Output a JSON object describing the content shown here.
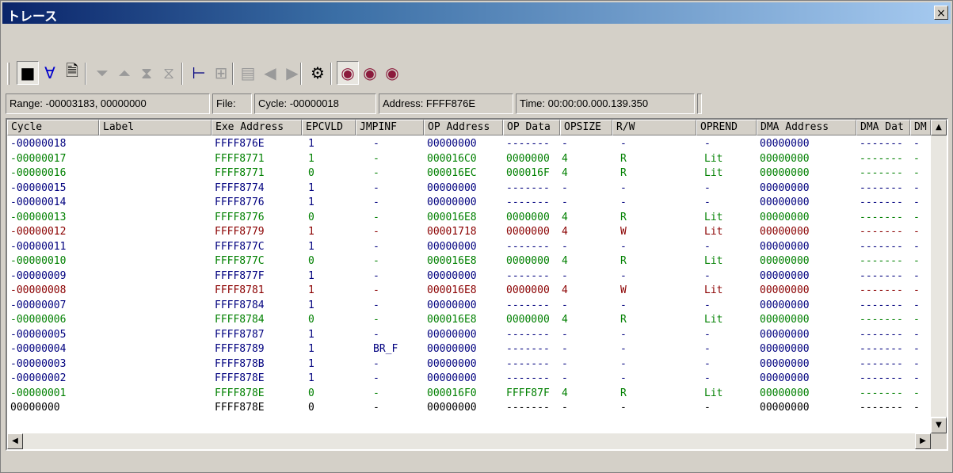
{
  "window": {
    "title": "トレース",
    "close_glyph": "×"
  },
  "toolbar": {
    "buttons": [
      {
        "name": "trace-display-icon",
        "glyph": "■",
        "color": "#000000",
        "pressed": true
      },
      {
        "name": "filter-icon",
        "glyph": "∀",
        "color": "#0000cc"
      },
      {
        "name": "document-icon",
        "glyph": "🗎",
        "color": "#000000"
      },
      {
        "name": "filter-down-icon",
        "glyph": "⏷",
        "color": "#9a9a9a",
        "disabled": true
      },
      {
        "name": "eject-up-icon",
        "glyph": "⏶",
        "color": "#9a9a9a",
        "disabled": true
      },
      {
        "name": "collapse-icon",
        "glyph": "⧗",
        "color": "#9a9a9a",
        "disabled": true
      },
      {
        "name": "expand-icon",
        "glyph": "⧖",
        "color": "#9a9a9a",
        "disabled": true
      },
      {
        "name": "tree-icon",
        "glyph": "⊢",
        "color": "#000080"
      },
      {
        "name": "tree-alt-icon",
        "glyph": "⊞",
        "color": "#9a9a9a",
        "disabled": true
      },
      {
        "name": "list-icon",
        "glyph": "▤",
        "color": "#9a9a9a",
        "disabled": true
      },
      {
        "name": "step-back-icon",
        "glyph": "◀",
        "color": "#9a9a9a",
        "disabled": true
      },
      {
        "name": "step-forward-icon",
        "glyph": "▶",
        "color": "#9a9a9a",
        "disabled": true
      },
      {
        "name": "properties-icon",
        "glyph": "⚙",
        "color": "#000000"
      },
      {
        "name": "record-zoom-icon",
        "glyph": "◉",
        "color": "#8b1a3c",
        "pressed": true
      },
      {
        "name": "record-stop-icon",
        "glyph": "◉",
        "color": "#8b1a3c"
      },
      {
        "name": "record-reset-icon",
        "glyph": "◉",
        "color": "#8b1a3c"
      }
    ]
  },
  "status_bar": {
    "range": "Range: -00003183, 00000000",
    "file": "File:",
    "cycle": "Cycle: -00000018",
    "address": "Address: FFFF876E",
    "time": "Time: 00:00:00.000.139.350"
  },
  "columns": [
    "Cycle",
    "Label",
    "Exe Address",
    "EPCVLD",
    "JMPINF",
    "OP Address",
    "OP Data",
    "OPSIZE",
    "R/W",
    "OPREND",
    "DMA Address",
    "DMA Dat",
    "DM"
  ],
  "colors": {
    "blue": "#00007f",
    "green": "#008000",
    "red": "#8b0000",
    "black": "#000000"
  },
  "rows": [
    {
      "c": "blue",
      "v": [
        "-00000018",
        "",
        "FFFF876E",
        "1",
        "-",
        "00000000",
        "-------",
        "-",
        "-",
        "-",
        "00000000",
        "-------",
        "-"
      ]
    },
    {
      "c": "green",
      "v": [
        "-00000017",
        "",
        "FFFF8771",
        "1",
        "-",
        "000016C0",
        "0000000",
        "4",
        "R",
        "Lit",
        "00000000",
        "-------",
        "-"
      ]
    },
    {
      "c": "green",
      "v": [
        "-00000016",
        "",
        "FFFF8771",
        "0",
        "-",
        "000016EC",
        "000016F",
        "4",
        "R",
        "Lit",
        "00000000",
        "-------",
        "-"
      ]
    },
    {
      "c": "blue",
      "v": [
        "-00000015",
        "",
        "FFFF8774",
        "1",
        "-",
        "00000000",
        "-------",
        "-",
        "-",
        "-",
        "00000000",
        "-------",
        "-"
      ]
    },
    {
      "c": "blue",
      "v": [
        "-00000014",
        "",
        "FFFF8776",
        "1",
        "-",
        "00000000",
        "-------",
        "-",
        "-",
        "-",
        "00000000",
        "-------",
        "-"
      ]
    },
    {
      "c": "green",
      "v": [
        "-00000013",
        "",
        "FFFF8776",
        "0",
        "-",
        "000016E8",
        "0000000",
        "4",
        "R",
        "Lit",
        "00000000",
        "-------",
        "-"
      ]
    },
    {
      "c": "red",
      "v": [
        "-00000012",
        "",
        "FFFF8779",
        "1",
        "-",
        "00001718",
        "0000000",
        "4",
        "W",
        "Lit",
        "00000000",
        "-------",
        "-"
      ]
    },
    {
      "c": "blue",
      "v": [
        "-00000011",
        "",
        "FFFF877C",
        "1",
        "-",
        "00000000",
        "-------",
        "-",
        "-",
        "-",
        "00000000",
        "-------",
        "-"
      ]
    },
    {
      "c": "green",
      "v": [
        "-00000010",
        "",
        "FFFF877C",
        "0",
        "-",
        "000016E8",
        "0000000",
        "4",
        "R",
        "Lit",
        "00000000",
        "-------",
        "-"
      ]
    },
    {
      "c": "blue",
      "v": [
        "-00000009",
        "",
        "FFFF877F",
        "1",
        "-",
        "00000000",
        "-------",
        "-",
        "-",
        "-",
        "00000000",
        "-------",
        "-"
      ]
    },
    {
      "c": "red",
      "v": [
        "-00000008",
        "",
        "FFFF8781",
        "1",
        "-",
        "000016E8",
        "0000000",
        "4",
        "W",
        "Lit",
        "00000000",
        "-------",
        "-"
      ]
    },
    {
      "c": "blue",
      "v": [
        "-00000007",
        "",
        "FFFF8784",
        "1",
        "-",
        "00000000",
        "-------",
        "-",
        "-",
        "-",
        "00000000",
        "-------",
        "-"
      ]
    },
    {
      "c": "green",
      "v": [
        "-00000006",
        "",
        "FFFF8784",
        "0",
        "-",
        "000016E8",
        "0000000",
        "4",
        "R",
        "Lit",
        "00000000",
        "-------",
        "-"
      ]
    },
    {
      "c": "blue",
      "v": [
        "-00000005",
        "",
        "FFFF8787",
        "1",
        "-",
        "00000000",
        "-------",
        "-",
        "-",
        "-",
        "00000000",
        "-------",
        "-"
      ]
    },
    {
      "c": "blue",
      "v": [
        "-00000004",
        "",
        "FFFF8789",
        "1",
        "BR_F",
        "00000000",
        "-------",
        "-",
        "-",
        "-",
        "00000000",
        "-------",
        "-"
      ]
    },
    {
      "c": "blue",
      "v": [
        "-00000003",
        "",
        "FFFF878B",
        "1",
        "-",
        "00000000",
        "-------",
        "-",
        "-",
        "-",
        "00000000",
        "-------",
        "-"
      ]
    },
    {
      "c": "blue",
      "v": [
        "-00000002",
        "",
        "FFFF878E",
        "1",
        "-",
        "00000000",
        "-------",
        "-",
        "-",
        "-",
        "00000000",
        "-------",
        "-"
      ]
    },
    {
      "c": "green",
      "v": [
        "-00000001",
        "",
        "FFFF878E",
        "0",
        "-",
        "000016F0",
        "FFFF87F",
        "4",
        "R",
        "Lit",
        "00000000",
        "-------",
        "-"
      ]
    },
    {
      "c": "black",
      "v": [
        "00000000",
        "",
        "FFFF878E",
        "0",
        "-",
        "00000000",
        "-------",
        "-",
        "-",
        "-",
        "00000000",
        "-------",
        "-"
      ]
    }
  ],
  "scroll": {
    "up": "▲",
    "down": "▼",
    "left": "◀",
    "right": "▶"
  }
}
